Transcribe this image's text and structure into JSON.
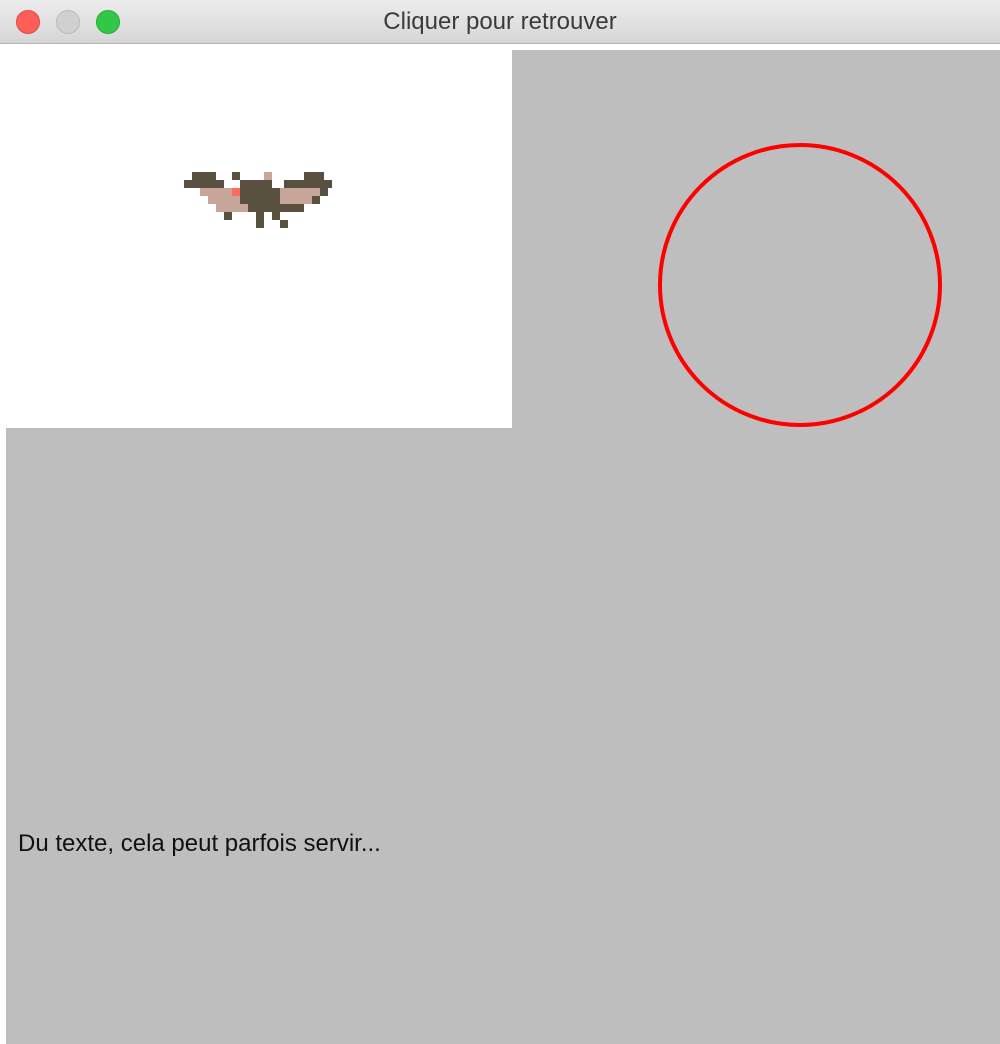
{
  "window": {
    "title": "Cliquer pour retrouver",
    "buttons": {
      "close": "close-button",
      "minimize": "minimize-button",
      "maximize": "maximize-button"
    }
  },
  "canvas": {
    "background_color": "#bebebe",
    "panel_color": "#ffffff",
    "circle_color": "#ff0000",
    "text": "Du texte, cela peut parfois servir...",
    "sprite": "bat-sprite"
  }
}
